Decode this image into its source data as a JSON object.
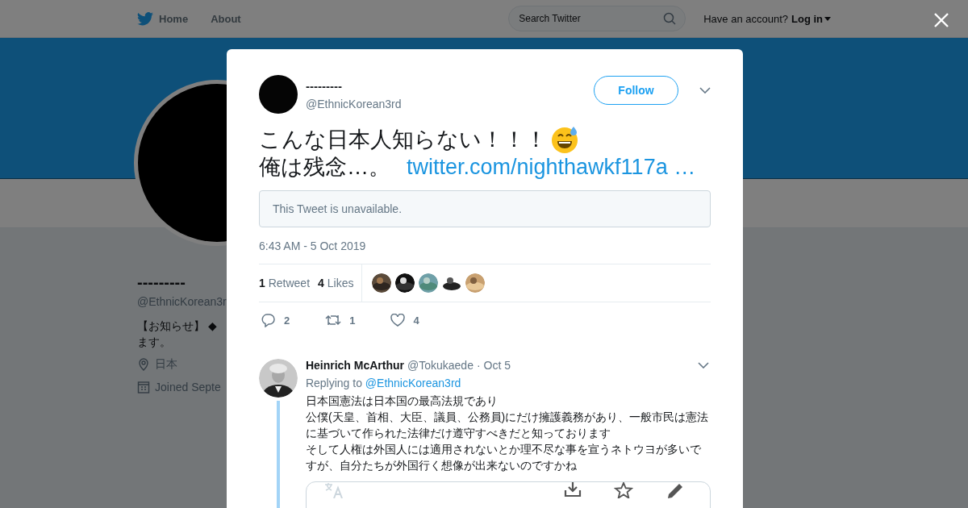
{
  "nav": {
    "items": [
      {
        "label": "Home",
        "kind": "home"
      },
      {
        "label": "About",
        "kind": "plain"
      }
    ],
    "search": {
      "placeholder": "Search Twitter"
    },
    "account_prompt": "Have an account?",
    "login": "Log in"
  },
  "profile": {
    "name": "---------",
    "handle": "@EthnicKorean3r",
    "bio_lines": [
      "【お知らせ】 ◆",
      "ます。"
    ],
    "location": "日本",
    "joined": "Joined Septe"
  },
  "tweet": {
    "author_name": "---------",
    "handle": "@EthnicKorean3rd",
    "follow": "Follow",
    "text_line_1": "こんな日本人知らない！！！",
    "text_line_2": "俺は残念…。",
    "link": "twitter.com/nighthawkf117a …",
    "quoted": "This Tweet is unavailable.",
    "timestamp": "6:43 AM - 5 Oct 2019",
    "stats": [
      {
        "count": "1",
        "label": "Retweet"
      },
      {
        "count": "4",
        "label": "Likes"
      }
    ],
    "actions": [
      {
        "kind": "reply",
        "count": "2"
      },
      {
        "kind": "retweet",
        "count": "1"
      },
      {
        "kind": "like",
        "count": "4"
      }
    ]
  },
  "reply": {
    "name": "Heinrich McArthur",
    "handle": "@Tokukaede",
    "date": "· Oct 5",
    "replying_label": "Replying to",
    "replying_to": "@EthnicKorean3rd",
    "paragraphs": [
      "日本国憲法は日本国の最高法規であり",
      "公僕(天皇、首相、大臣、議員、公務員)にだけ擁護義務があり、一般市民は憲法に基づいて作られた法律だけ遵守すべきだと知っております",
      "そして人権は外国人には適用されないとか理不尽な事を宣うネトウヨが多いですが、自分たちが外国行く想像が出来ないのですかね"
    ],
    "card_tools": [
      {
        "kind": "translate"
      },
      {
        "kind": "download"
      },
      {
        "kind": "star"
      },
      {
        "kind": "edit"
      }
    ]
  }
}
